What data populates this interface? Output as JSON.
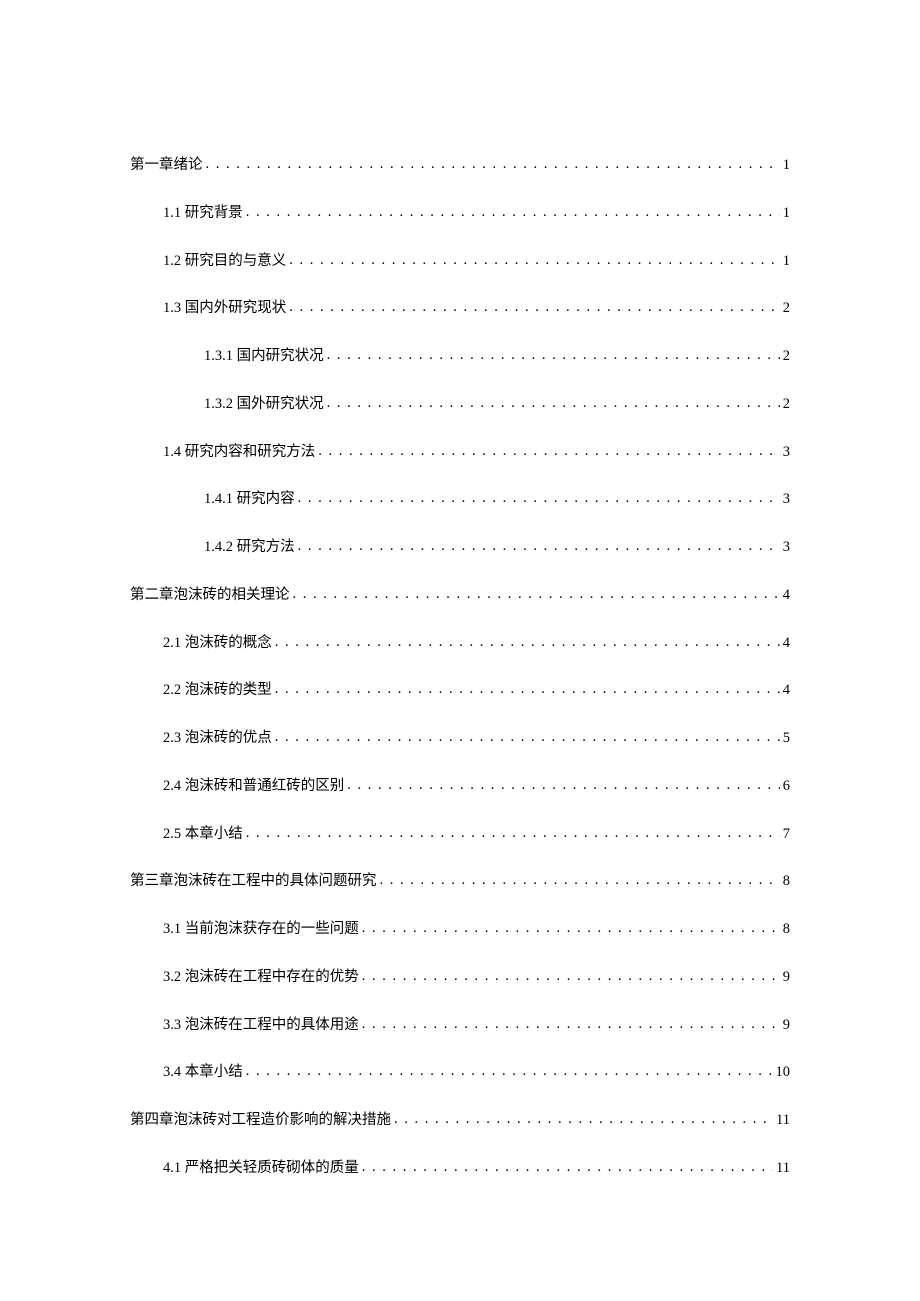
{
  "toc": [
    {
      "level": 0,
      "label": "第一章绪论",
      "page": "1"
    },
    {
      "level": 1,
      "label": "1.1  研究背景",
      "page": "1"
    },
    {
      "level": 1,
      "label": "1.2  研究目的与意义",
      "page": "1"
    },
    {
      "level": 1,
      "label": "1.3  国内外研究现状",
      "page": "2"
    },
    {
      "level": 2,
      "label": "1.3.1  国内研究状况",
      "page": "2"
    },
    {
      "level": 2,
      "label": "1.3.2  国外研究状况",
      "page": "2"
    },
    {
      "level": 1,
      "label": "1.4  研究内容和研究方法",
      "page": "3"
    },
    {
      "level": 2,
      "label": "1.4.1  研究内容",
      "page": "3"
    },
    {
      "level": 2,
      "label": "1.4.2  研究方法",
      "page": "3"
    },
    {
      "level": 0,
      "label": "第二章泡沫砖的相关理论",
      "page": "4"
    },
    {
      "level": 1,
      "label": "2.1  泡沫砖的概念",
      "page": "4"
    },
    {
      "level": 1,
      "label": "2.2  泡沫砖的类型",
      "page": "4"
    },
    {
      "level": 1,
      "label": "2.3  泡沫砖的优点",
      "page": "5"
    },
    {
      "level": 1,
      "label": "2.4  泡沫砖和普通红砖的区别",
      "page": "6"
    },
    {
      "level": 1,
      "label": "2.5  本章小结",
      "page": "7"
    },
    {
      "level": 0,
      "label": "第三章泡沫砖在工程中的具体问题研究",
      "page": "8"
    },
    {
      "level": 1,
      "label": "3.1  当前泡沫获存在的一些问题",
      "page": "8"
    },
    {
      "level": 1,
      "label": "3.2  泡沫砖在工程中存在的优势",
      "page": "9"
    },
    {
      "level": 1,
      "label": "3.3  泡沫砖在工程中的具体用途",
      "page": "9"
    },
    {
      "level": 1,
      "label": "3.4  本章小结",
      "page": "10"
    },
    {
      "level": 0,
      "label": "第四章泡沫砖对工程造价影响的解决措施",
      "page": "11"
    },
    {
      "level": 1,
      "label": "4.1  严格把关轻质砖砌体的质量",
      "page": "11"
    }
  ]
}
